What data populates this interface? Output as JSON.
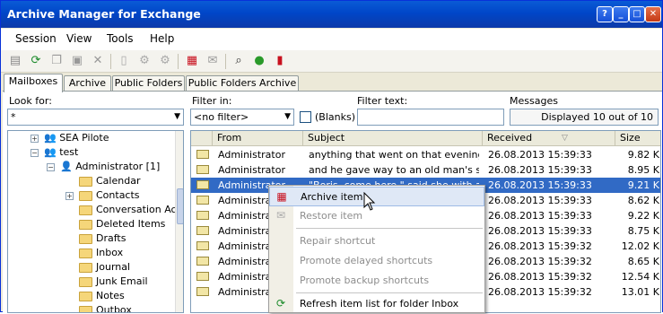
{
  "window": {
    "title": "Archive Manager for Exchange",
    "minimize": "_",
    "maximize": "□",
    "close": "✕",
    "help": "?"
  },
  "menu": [
    "Session",
    "View",
    "Tools",
    "Help"
  ],
  "toolbar_icons": [
    "properties-icon",
    "refresh-icon",
    "copy-icon",
    "paste-icon",
    "delete-icon",
    "document-icon",
    "gear-icon",
    "settings-icon",
    "archive-icon",
    "restore-icon",
    "search-icon",
    "go-icon",
    "book-icon"
  ],
  "tabs": [
    "Mailboxes",
    "Archive",
    "Public Folders",
    "Public Folders Archive"
  ],
  "filters": {
    "look_for_label": "Look for:",
    "look_for_value": "*",
    "filter_in_label": "Filter in:",
    "filter_in_value": "<no filter>",
    "blanks_label": "(Blanks)",
    "filter_text_label": "Filter text:",
    "filter_text_value": "",
    "messages_label": "Messages",
    "messages_value": "Displayed 10 out of 10"
  },
  "tree": [
    {
      "label": "SEA Pilote"
    },
    {
      "label": "test"
    },
    {
      "label": "Administrator [1]"
    },
    {
      "label": "Calendar"
    },
    {
      "label": "Contacts"
    },
    {
      "label": "Conversation Act"
    },
    {
      "label": "Deleted Items"
    },
    {
      "label": "Drafts"
    },
    {
      "label": "Inbox"
    },
    {
      "label": "Journal"
    },
    {
      "label": "Junk Email"
    },
    {
      "label": "Notes"
    },
    {
      "label": "Outbox"
    }
  ],
  "columns": {
    "from": "From",
    "subject": "Subject",
    "received": "Received",
    "size": "Size"
  },
  "rows": [
    {
      "from": "Administrator",
      "subject": "anything that went on that evening. T...",
      "received": "26.08.2013 15:39:33",
      "size": "9.82 K"
    },
    {
      "from": "Administrator",
      "subject": "and he gave way to an old man's sob.",
      "received": "26.08.2013 15:39:33",
      "size": "8.95 K"
    },
    {
      "from": "Administrator",
      "subject": "\"Boris, come here,\" said she with a sl...",
      "received": "26.08.2013 15:39:33",
      "size": "9.21 K"
    },
    {
      "from": "Administrator",
      "subject": "",
      "received": "26.08.2013 15:39:33",
      "size": "8.62 K"
    },
    {
      "from": "Administrator",
      "subject": "",
      "received": "26.08.2013 15:39:33",
      "size": "9.22 K"
    },
    {
      "from": "Administrator",
      "subject": "",
      "received": "26.08.2013 15:39:33",
      "size": "8.75 K"
    },
    {
      "from": "Administrator",
      "subject": "",
      "received": "26.08.2013 15:39:32",
      "size": "12.02 K"
    },
    {
      "from": "Administrator",
      "subject": "",
      "received": "26.08.2013 15:39:32",
      "size": "8.65 K"
    },
    {
      "from": "Administrator",
      "subject": "",
      "received": "26.08.2013 15:39:32",
      "size": "12.54 K"
    },
    {
      "from": "Administrator",
      "subject": "",
      "received": "26.08.2013 15:39:32",
      "size": "13.01 K"
    }
  ],
  "context_menu": {
    "archive": "Archive item",
    "restore": "Restore item",
    "repair": "Repair shortcut",
    "promote_delayed": "Promote delayed shortcuts",
    "promote_backup": "Promote backup shortcuts",
    "refresh": "Refresh item list for folder Inbox"
  }
}
